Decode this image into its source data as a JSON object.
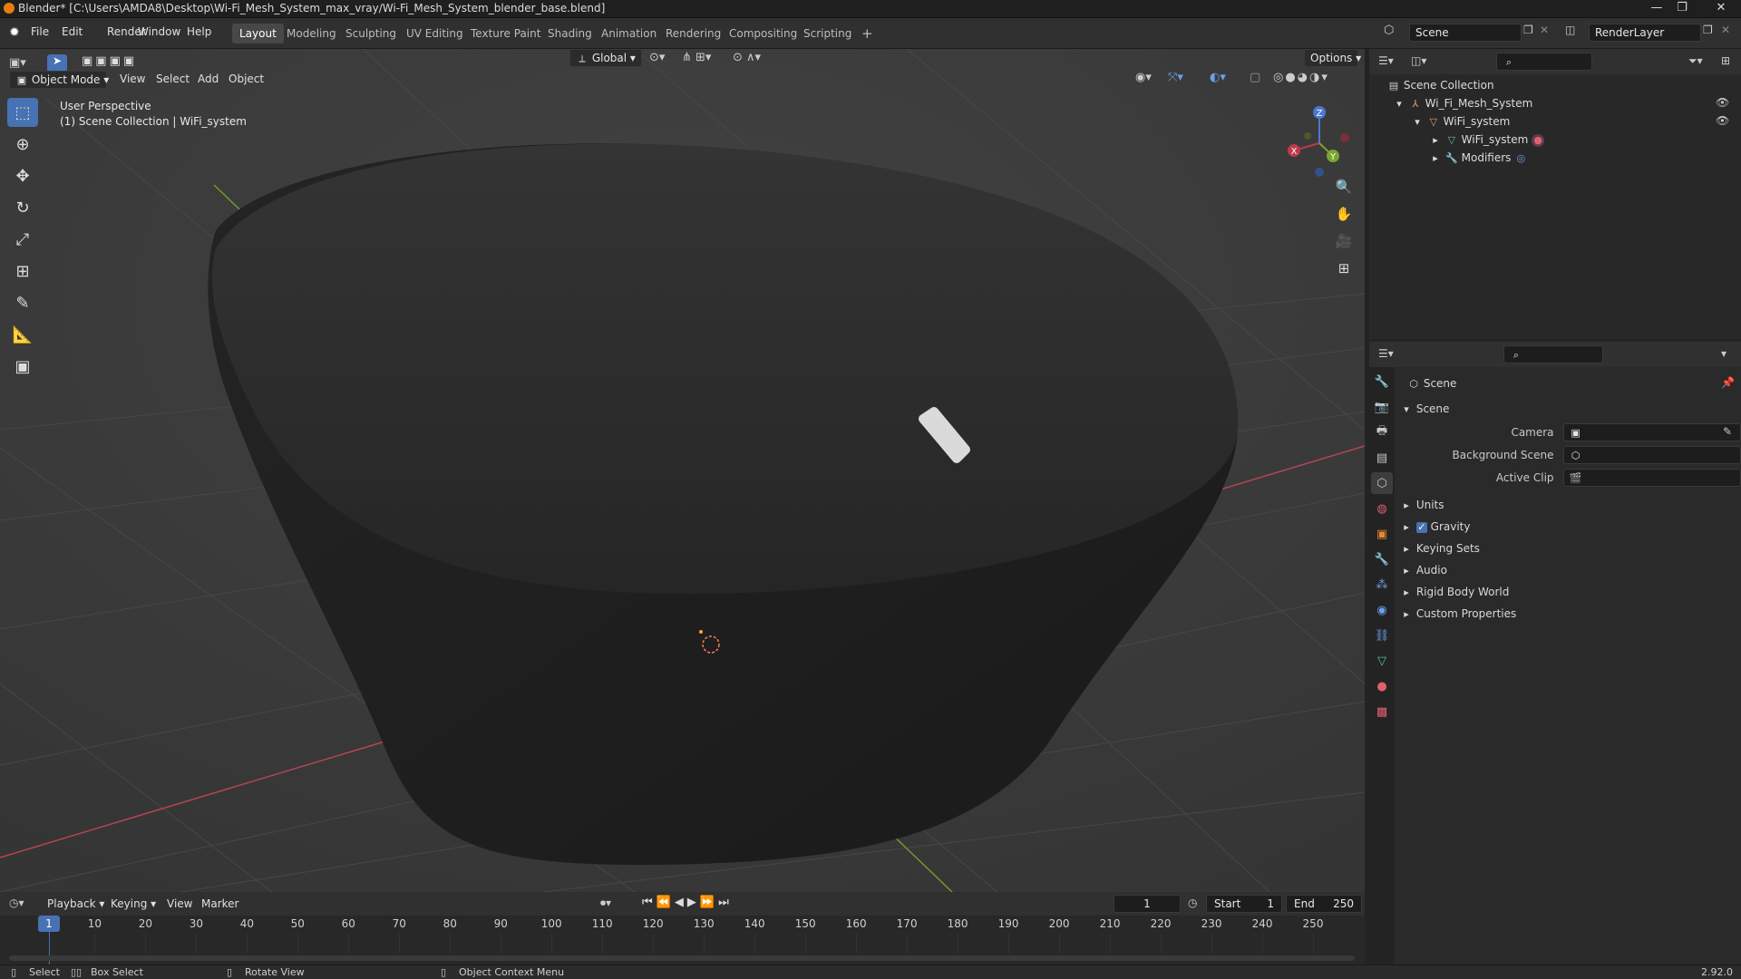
{
  "window": {
    "title": "Blender* [C:\\Users\\AMDA8\\Desktop\\Wi-Fi_Mesh_System_max_vray/Wi-Fi_Mesh_System_blender_base.blend]",
    "controls": [
      "—",
      "❐",
      "✕"
    ]
  },
  "menus": [
    "File",
    "Edit",
    "Render",
    "Window",
    "Help"
  ],
  "workspaces": [
    {
      "label": "Layout",
      "active": true
    },
    {
      "label": "Modeling"
    },
    {
      "label": "Sculpting"
    },
    {
      "label": "UV Editing"
    },
    {
      "label": "Texture Paint"
    },
    {
      "label": "Shading"
    },
    {
      "label": "Animation"
    },
    {
      "label": "Rendering"
    },
    {
      "label": "Compositing"
    },
    {
      "label": "Scripting"
    }
  ],
  "add_workspace": "+",
  "scene_selector": "Scene",
  "renderlayer_selector": "RenderLayer",
  "viewport": {
    "transform_orientation": "Global",
    "options_label": "Options",
    "mode": "Object Mode",
    "menus": [
      "View",
      "Select",
      "Add",
      "Object"
    ],
    "overlay_line1": "User Perspective",
    "overlay_line2": "(1) Scene Collection | WiFi_system",
    "gizmo_axes": {
      "x": "X",
      "y": "Y",
      "z": "Z"
    },
    "colors": {
      "object": "#2b2b2b",
      "xaxis": "#c0394a",
      "yaxis": "#7aa62e",
      "grid": "#454545"
    }
  },
  "outliner": {
    "rows": [
      {
        "label": "Scene Collection",
        "depth": 0,
        "icon": "collection"
      },
      {
        "label": "Wi_Fi_Mesh_System",
        "depth": 1,
        "icon": "empty",
        "expanded": true,
        "visible": true
      },
      {
        "label": "WiFi_system",
        "depth": 2,
        "icon": "mesh-object",
        "expanded": true,
        "visible": true
      },
      {
        "label": "WiFi_system",
        "depth": 3,
        "icon": "mesh-data",
        "expanded": false
      },
      {
        "label": "Modifiers",
        "depth": 3,
        "icon": "wrench",
        "expanded": false
      }
    ]
  },
  "properties": {
    "breadcrumb": "Scene",
    "panel_title": "Scene",
    "fields": [
      {
        "label": "Camera",
        "value": ""
      },
      {
        "label": "Background Scene",
        "value": ""
      },
      {
        "label": "Active Clip",
        "value": ""
      }
    ],
    "subpanels": [
      {
        "label": "Units",
        "checkbox": false
      },
      {
        "label": "Gravity",
        "checkbox": true
      },
      {
        "label": "Keying Sets",
        "checkbox": false
      },
      {
        "label": "Audio",
        "checkbox": false
      },
      {
        "label": "Rigid Body World",
        "checkbox": false
      },
      {
        "label": "Custom Properties",
        "checkbox": false
      }
    ]
  },
  "timeline": {
    "menus": [
      "Playback",
      "Keying",
      "View",
      "Marker"
    ],
    "current_frame": "1",
    "start_label": "Start",
    "start": "1",
    "end_label": "End",
    "end": "250",
    "ticks": [
      "1",
      "10",
      "20",
      "30",
      "40",
      "50",
      "60",
      "70",
      "80",
      "90",
      "100",
      "110",
      "120",
      "130",
      "140",
      "150",
      "160",
      "170",
      "180",
      "190",
      "200",
      "210",
      "220",
      "230",
      "240",
      "250"
    ],
    "playhead_frame": 1,
    "frame_min": 1,
    "frame_max": 250
  },
  "statusbar": {
    "select": "Select",
    "box_select": "Box Select",
    "rotate_view": "Rotate View",
    "context_menu": "Object Context Menu",
    "version": "2.92.0"
  }
}
